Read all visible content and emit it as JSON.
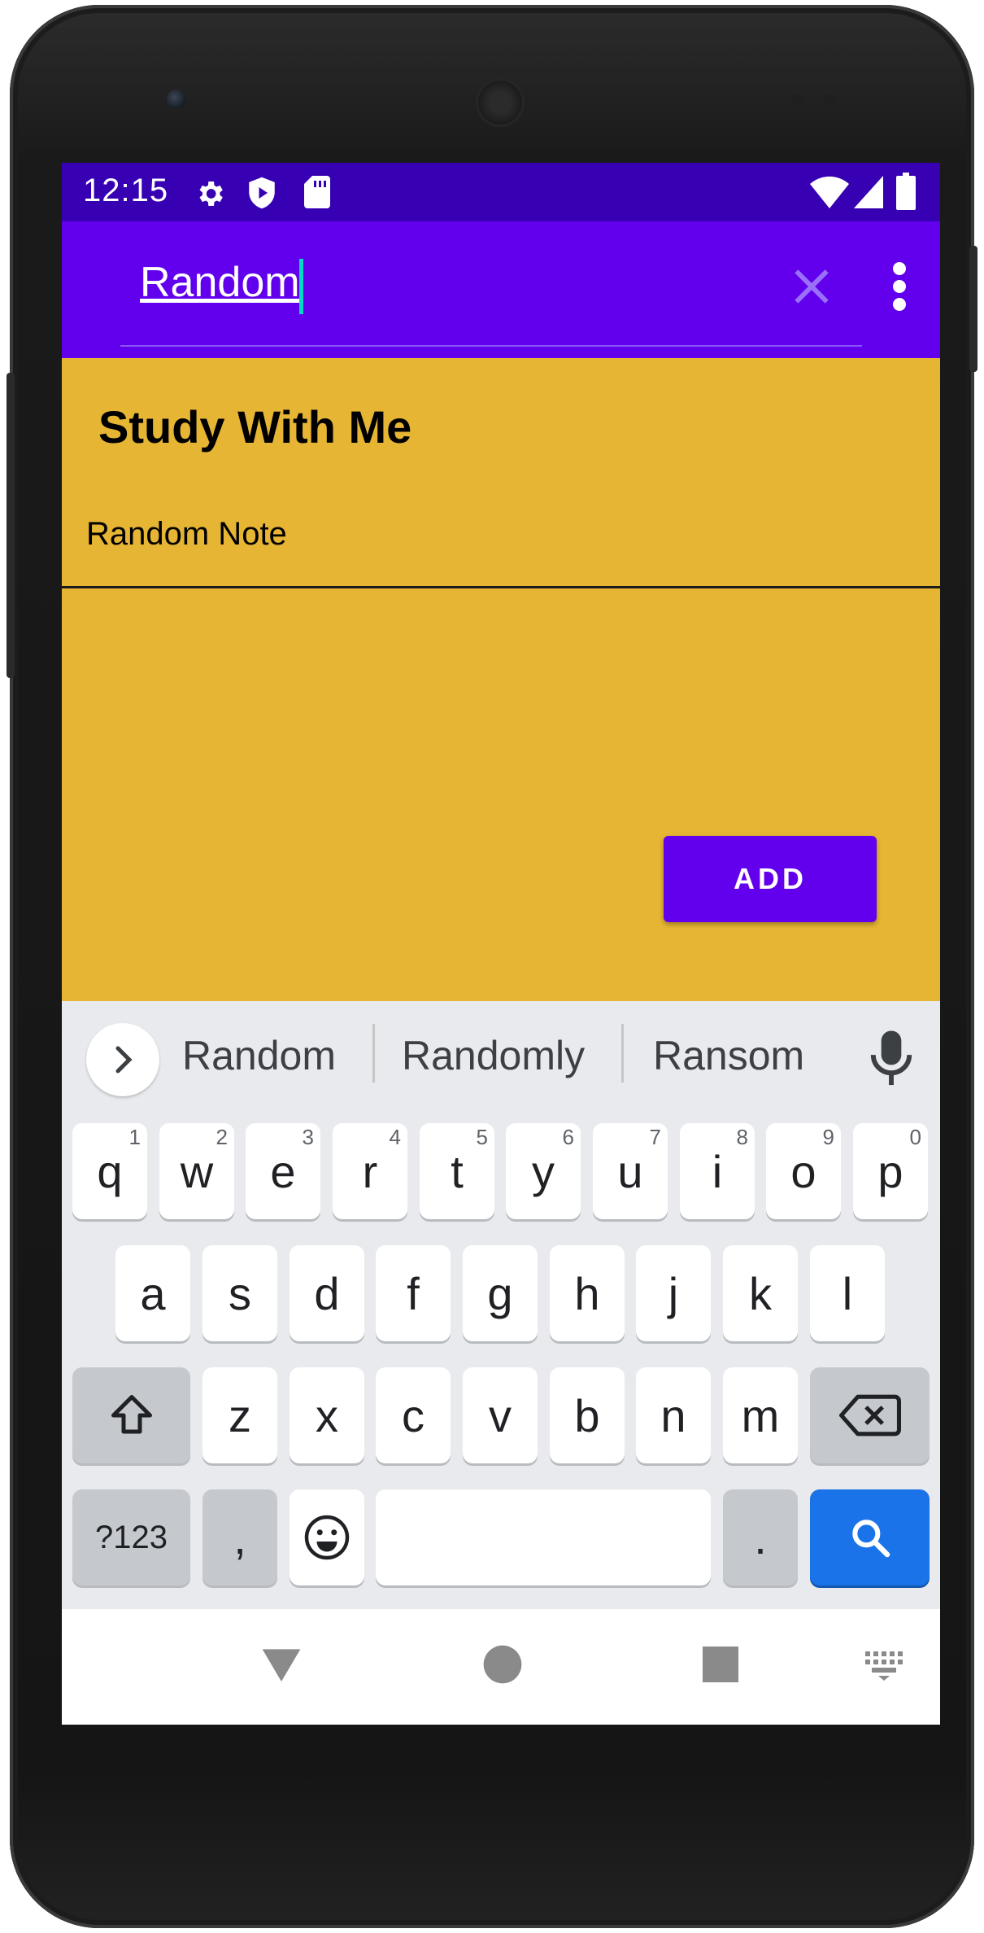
{
  "status_bar": {
    "time": "12:15"
  },
  "app_bar": {
    "search_value": "Random",
    "clear_icon": "close-icon",
    "menu_icon": "more-vert-icon"
  },
  "content": {
    "title": "Study With Me",
    "notes": [
      "Random Note"
    ],
    "add_label": "ADD"
  },
  "keyboard": {
    "suggestions": [
      "Random",
      "Randomly",
      "Ransom"
    ],
    "row1": [
      {
        "k": "q",
        "h": "1"
      },
      {
        "k": "w",
        "h": "2"
      },
      {
        "k": "e",
        "h": "3"
      },
      {
        "k": "r",
        "h": "4"
      },
      {
        "k": "t",
        "h": "5"
      },
      {
        "k": "y",
        "h": "6"
      },
      {
        "k": "u",
        "h": "7"
      },
      {
        "k": "i",
        "h": "8"
      },
      {
        "k": "o",
        "h": "9"
      },
      {
        "k": "p",
        "h": "0"
      }
    ],
    "row2": [
      "a",
      "s",
      "d",
      "f",
      "g",
      "h",
      "j",
      "k",
      "l"
    ],
    "row3": [
      "z",
      "x",
      "c",
      "v",
      "b",
      "n",
      "m"
    ],
    "symbols_label": "?123",
    "comma": ",",
    "period": "."
  },
  "colors": {
    "status_bar": "#3700b3",
    "app_bar": "#6200ee",
    "background": "#e6b533",
    "search_key": "#1a73e8"
  }
}
